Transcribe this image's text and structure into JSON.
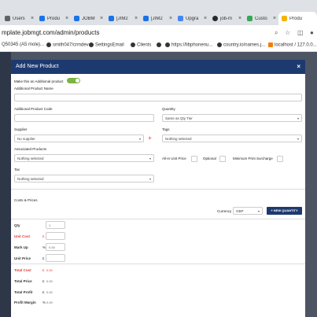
{
  "browser": {
    "tabs": [
      {
        "label": "Users",
        "icon_color": "#5f6368"
      },
      {
        "label": "Produ",
        "icon_color": "#1a73e8"
      },
      {
        "label": "JOBM",
        "icon_color": "#1a73e8"
      },
      {
        "label": "[JIM2",
        "icon_color": "#1a73e8"
      },
      {
        "label": "[JIM2",
        "icon_color": "#1a73e8"
      },
      {
        "label": "Upgra",
        "icon_color": "#4285f4"
      },
      {
        "label": "job-m",
        "icon_color": "#24292e"
      },
      {
        "label": "Custo",
        "icon_color": "#34a853"
      },
      {
        "label": "Produ",
        "icon_color": "#f4b400"
      }
    ],
    "url": "mplate.jobmgt.com/admin/products",
    "bookmarks": [
      "Q50345 (A5 mole)...",
      "smith047/crmdev",
      "SettingsEmail",
      "Clients",
      "",
      "https://libphonenu...",
      "country.io/names.j...",
      "localhost / 127.0.0..."
    ]
  },
  "modal": {
    "title": "Add New Product",
    "close": "×",
    "additional_toggle_label": "Make this an Additional product",
    "additional_name_label": "Additional Product Name",
    "additional_code_label": "Additional Product Code",
    "quantity_label": "Quantity",
    "quantity_value": "Same as Qty Tier",
    "supplier_label": "Supplier",
    "supplier_value": "No supplier",
    "tags_label": "Tags",
    "tags_value": "Nothing selected",
    "associated_label": "Associated Products",
    "associated_value": "Nothing selected",
    "allin_label": "All-in Unit Price",
    "optional_label": "Optional",
    "min_surcharge_label": "Minimum Print Surcharge",
    "tax_label": "Tax",
    "tax_value": "Nothing selected",
    "costs_heading": "Costs & Prices",
    "currency_label": "Currency",
    "currency_value": "GBP",
    "new_quantity": "+ NEW QUANTITY",
    "rows": {
      "qty": {
        "label": "Qty",
        "value": "1"
      },
      "unit_cost": {
        "label": "Unit Cost",
        "currency": "£"
      },
      "mark_up": {
        "label": "Mark Up",
        "currency": "%",
        "value": "0.00"
      },
      "unit_price": {
        "label": "Unit Price",
        "currency": "£"
      },
      "total_cost": {
        "label": "Total Cost",
        "currency": "£",
        "value": "0.00"
      },
      "total_price": {
        "label": "Total Price",
        "currency": "£",
        "value": "0.00"
      },
      "total_profit": {
        "label": "Total Profit",
        "currency": "£",
        "value": "0.00"
      },
      "profit_margin": {
        "label": "Profit Margin",
        "currency": "%",
        "value": "0.00"
      }
    }
  },
  "colors": {
    "header": "#1d3a70",
    "toggle": "#7cb342",
    "warn": "#e53935"
  }
}
